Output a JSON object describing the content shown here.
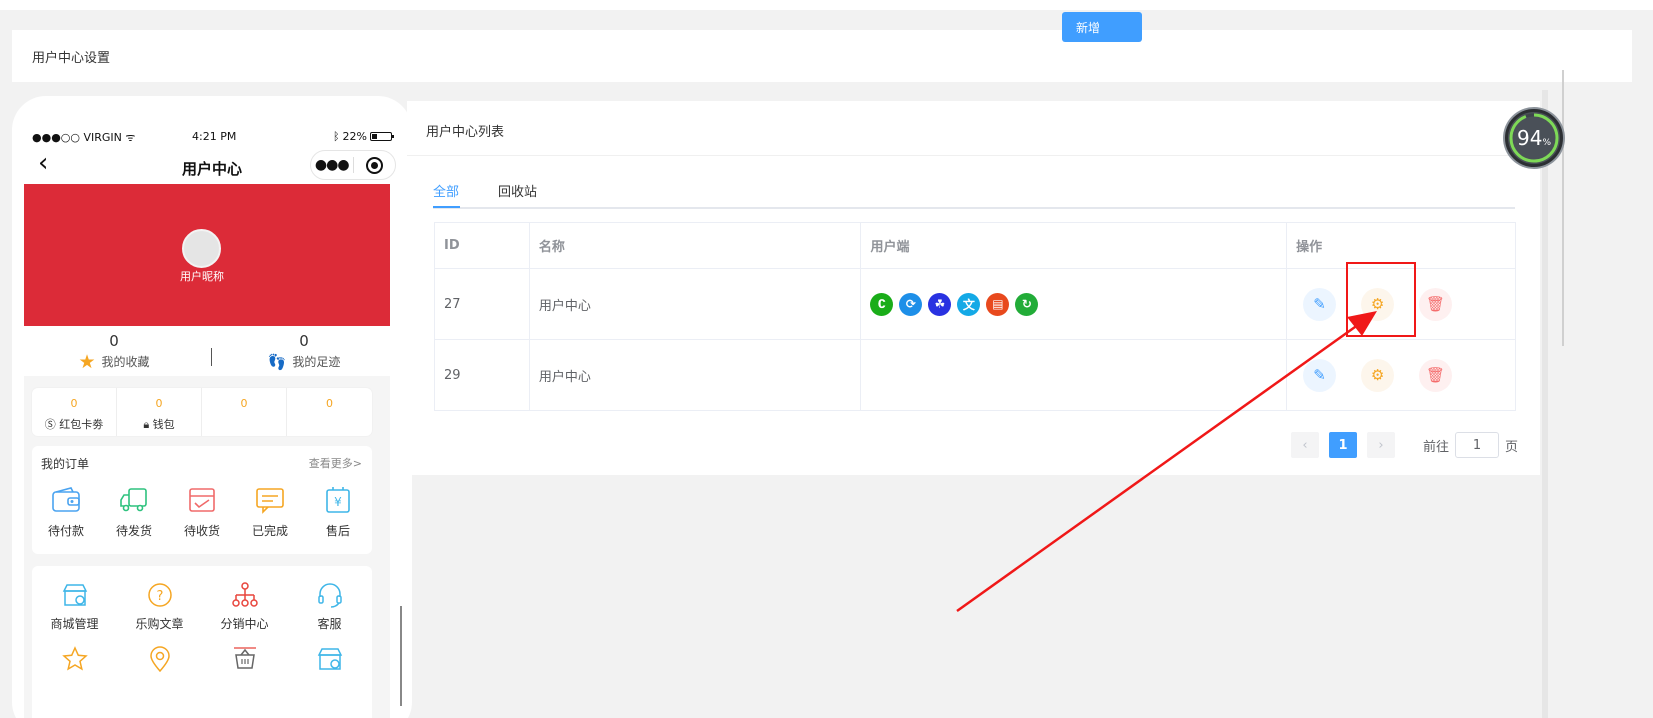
{
  "header": {
    "title": "用户中心设置"
  },
  "phone": {
    "status": {
      "carrier": "●●●○○ VIRGIN ᯤ",
      "time": "4:21 PM",
      "battery": "22%"
    },
    "nav_title": "用户中心",
    "nickname": "用户昵称",
    "stats": [
      {
        "value": "0",
        "label": "我的收藏"
      },
      {
        "value": "0",
        "label": "我的足迹"
      }
    ],
    "wallet": [
      {
        "value": "0",
        "label": "红包卡劵"
      },
      {
        "value": "0",
        "label": "钱包"
      },
      {
        "value": "0",
        "label": ""
      },
      {
        "value": "0",
        "label": ""
      }
    ],
    "orders": {
      "title": "我的订单",
      "more": "查看更多>",
      "items": [
        "待付款",
        "待发货",
        "待收货",
        "已完成",
        "售后"
      ]
    },
    "tools": [
      "商城管理",
      "乐购文章",
      "分销中心",
      "客服"
    ]
  },
  "panel": {
    "title": "用户中心列表",
    "add_label": "新增",
    "tabs": [
      "全部",
      "回收站"
    ],
    "columns": [
      "ID",
      "名称",
      "用户端",
      "操作"
    ],
    "rows": [
      {
        "id": "27",
        "name": "用户中心"
      },
      {
        "id": "29",
        "name": "用户中心"
      }
    ],
    "client_icons": [
      "wechat-miniapp-icon",
      "alipay-icon",
      "baidu-icon",
      "toutiao-icon",
      "h5-icon",
      "wechat-official-icon"
    ],
    "client_colors": [
      "#1aad19",
      "#1e8fe8",
      "#2932e1",
      "#14a9e6",
      "#e8491d",
      "#22ac38"
    ],
    "pager": {
      "current": "1",
      "goto_prefix": "前往",
      "goto_suffix": "页",
      "goto_value": "1"
    }
  },
  "gauge": {
    "value": "94",
    "unit": "%"
  }
}
